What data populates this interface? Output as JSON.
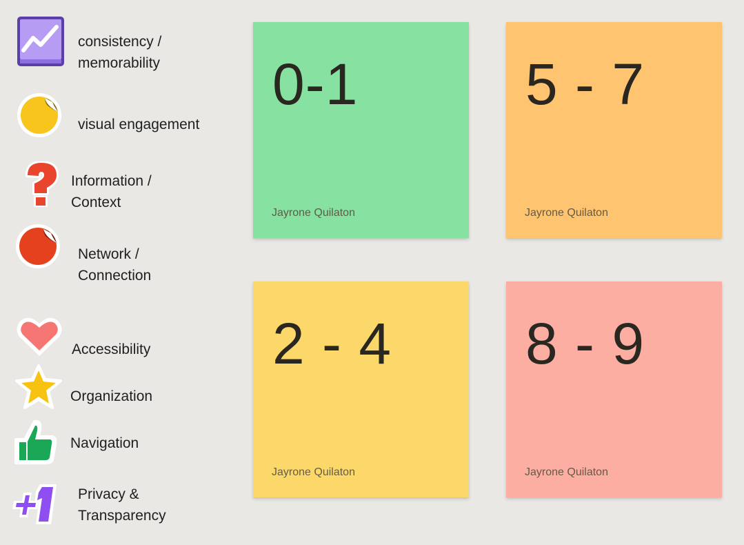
{
  "colors": {
    "canvas_background": "#e9e8e4",
    "note_green": "#87e1a1",
    "note_orange": "#fec470",
    "note_yellow": "#fcd86a",
    "note_red": "#fdaea3"
  },
  "legend": [
    {
      "icon": "trending-chart-icon",
      "lines": [
        "consistency /",
        "memorability"
      ]
    },
    {
      "icon": "yellow-dot-sticker-icon",
      "lines": [
        "visual engagement"
      ]
    },
    {
      "icon": "question-mark-icon",
      "lines": [
        "Information /",
        "Context"
      ]
    },
    {
      "icon": "red-dot-sticker-icon",
      "lines": [
        "Network /",
        "Connection"
      ]
    },
    {
      "icon": "heart-icon",
      "lines": [
        "Accessibility"
      ]
    },
    {
      "icon": "star-icon",
      "lines": [
        "Organization"
      ]
    },
    {
      "icon": "thumbs-up-icon",
      "lines": [
        "Navigation"
      ]
    },
    {
      "icon": "plus-one-icon",
      "lines": [
        "Privacy &",
        "Transparency"
      ]
    }
  ],
  "notes": [
    {
      "score": "0-1",
      "author": "Jayrone Quilaton",
      "color": "#87e1a1"
    },
    {
      "score": "5 - 7",
      "author": "Jayrone Quilaton",
      "color": "#fec470"
    },
    {
      "score": "2 - 4",
      "author": "Jayrone Quilaton",
      "color": "#fcd86a"
    },
    {
      "score": "8 - 9",
      "author": "Jayrone Quilaton",
      "color": "#fdaea3"
    }
  ]
}
